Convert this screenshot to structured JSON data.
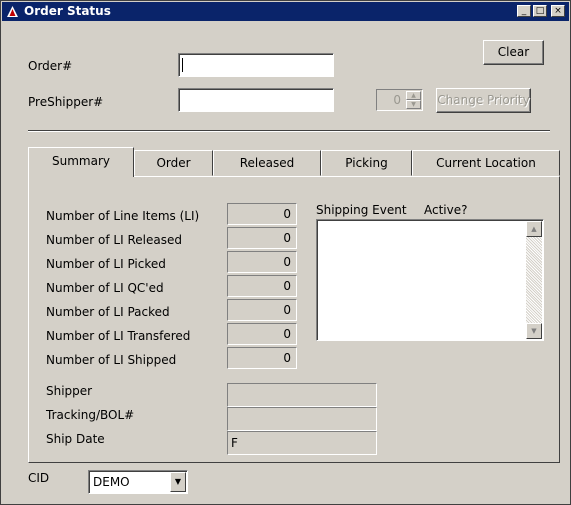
{
  "window": {
    "title": "Order Status"
  },
  "titlebar_buttons": {
    "minimize": "_",
    "maximize": "□",
    "close": "×"
  },
  "form": {
    "order_label": "Order#",
    "order_value": "",
    "preshipper_label": "PreShipper#",
    "preshipper_value": "",
    "priority_value": "0",
    "clear_button": "Clear",
    "change_priority_button": "Change Priority"
  },
  "tabs": [
    {
      "label": "Summary",
      "active": true
    },
    {
      "label": "Order",
      "active": false
    },
    {
      "label": "Released",
      "active": false
    },
    {
      "label": "Picking",
      "active": false
    },
    {
      "label": "Current Location",
      "active": false
    }
  ],
  "summary": {
    "rows": [
      {
        "label": "Number of Line Items (LI)",
        "value": "0"
      },
      {
        "label": "Number of LI Released",
        "value": "0"
      },
      {
        "label": "Number of LI Picked",
        "value": "0"
      },
      {
        "label": "Number of LI QC'ed",
        "value": "0"
      },
      {
        "label": "Number of LI Packed",
        "value": "0"
      },
      {
        "label": "Number of LI Transfered",
        "value": "0"
      },
      {
        "label": "Number of LI Shipped",
        "value": "0"
      }
    ],
    "shipping_event_header": "Shipping Event",
    "active_header": "Active?",
    "shipper_label": "Shipper",
    "shipper_value": "",
    "tracking_label": "Tracking/BOL#",
    "tracking_value": "",
    "ship_date_label": "Ship Date",
    "ship_date_value": "F"
  },
  "cid": {
    "label": "CID",
    "value": "DEMO"
  },
  "colors": {
    "titlebar": "#0a246a",
    "face": "#d4d0c8",
    "shadow": "#808080"
  }
}
